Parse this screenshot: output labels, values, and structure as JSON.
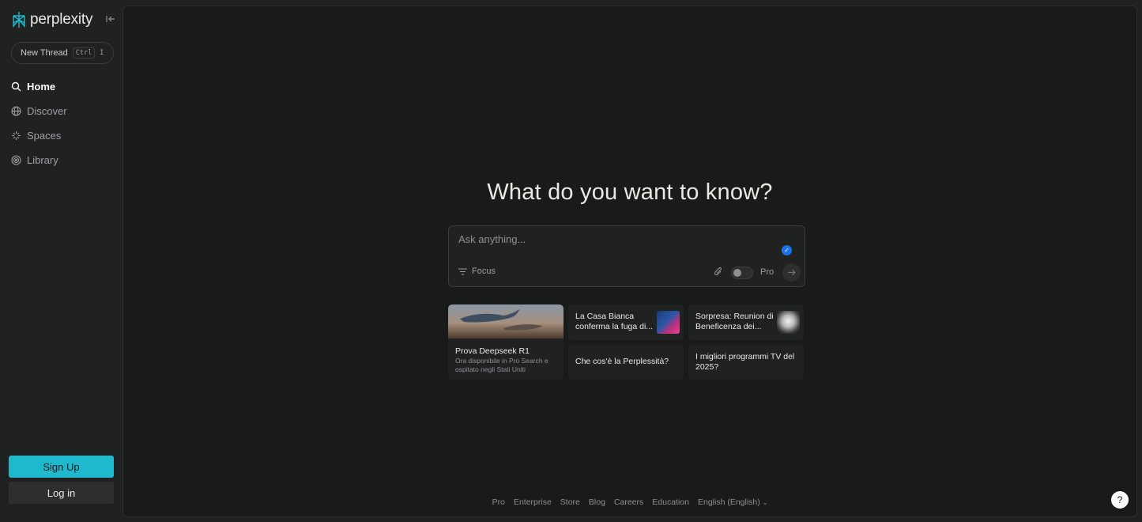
{
  "brand": {
    "name": "perplexity",
    "accent": "#20b8cd"
  },
  "sidebar": {
    "new_thread": {
      "label": "New Thread",
      "shortcut_mod": "Ctrl",
      "shortcut_key": "I"
    },
    "items": [
      {
        "label": "Home",
        "icon": "search-icon",
        "active": true
      },
      {
        "label": "Discover",
        "icon": "globe-icon",
        "active": false
      },
      {
        "label": "Spaces",
        "icon": "spaces-icon",
        "active": false
      },
      {
        "label": "Library",
        "icon": "library-icon",
        "active": false
      }
    ],
    "signup_label": "Sign Up",
    "login_label": "Log in"
  },
  "main": {
    "heading": "What do you want to know?",
    "ask": {
      "placeholder": "Ask anything...",
      "focus_label": "Focus",
      "pro_label": "Pro"
    },
    "cards": {
      "feature": {
        "title": "Prova Deepseek R1",
        "subtitle": "Ora disponibile in Pro Search e ospitato negli Stati Uniti"
      },
      "news1": "La Casa Bianca conferma la fuga di...",
      "news2": "Sorpresa: Reunion di Beneficenza dei...",
      "q1": "Che cos'è la Perplessità?",
      "q2": "I migliori programmi TV del 2025?"
    }
  },
  "footer": {
    "links": [
      "Pro",
      "Enterprise",
      "Store",
      "Blog",
      "Careers",
      "Education",
      "English (English)"
    ]
  },
  "help_label": "?"
}
